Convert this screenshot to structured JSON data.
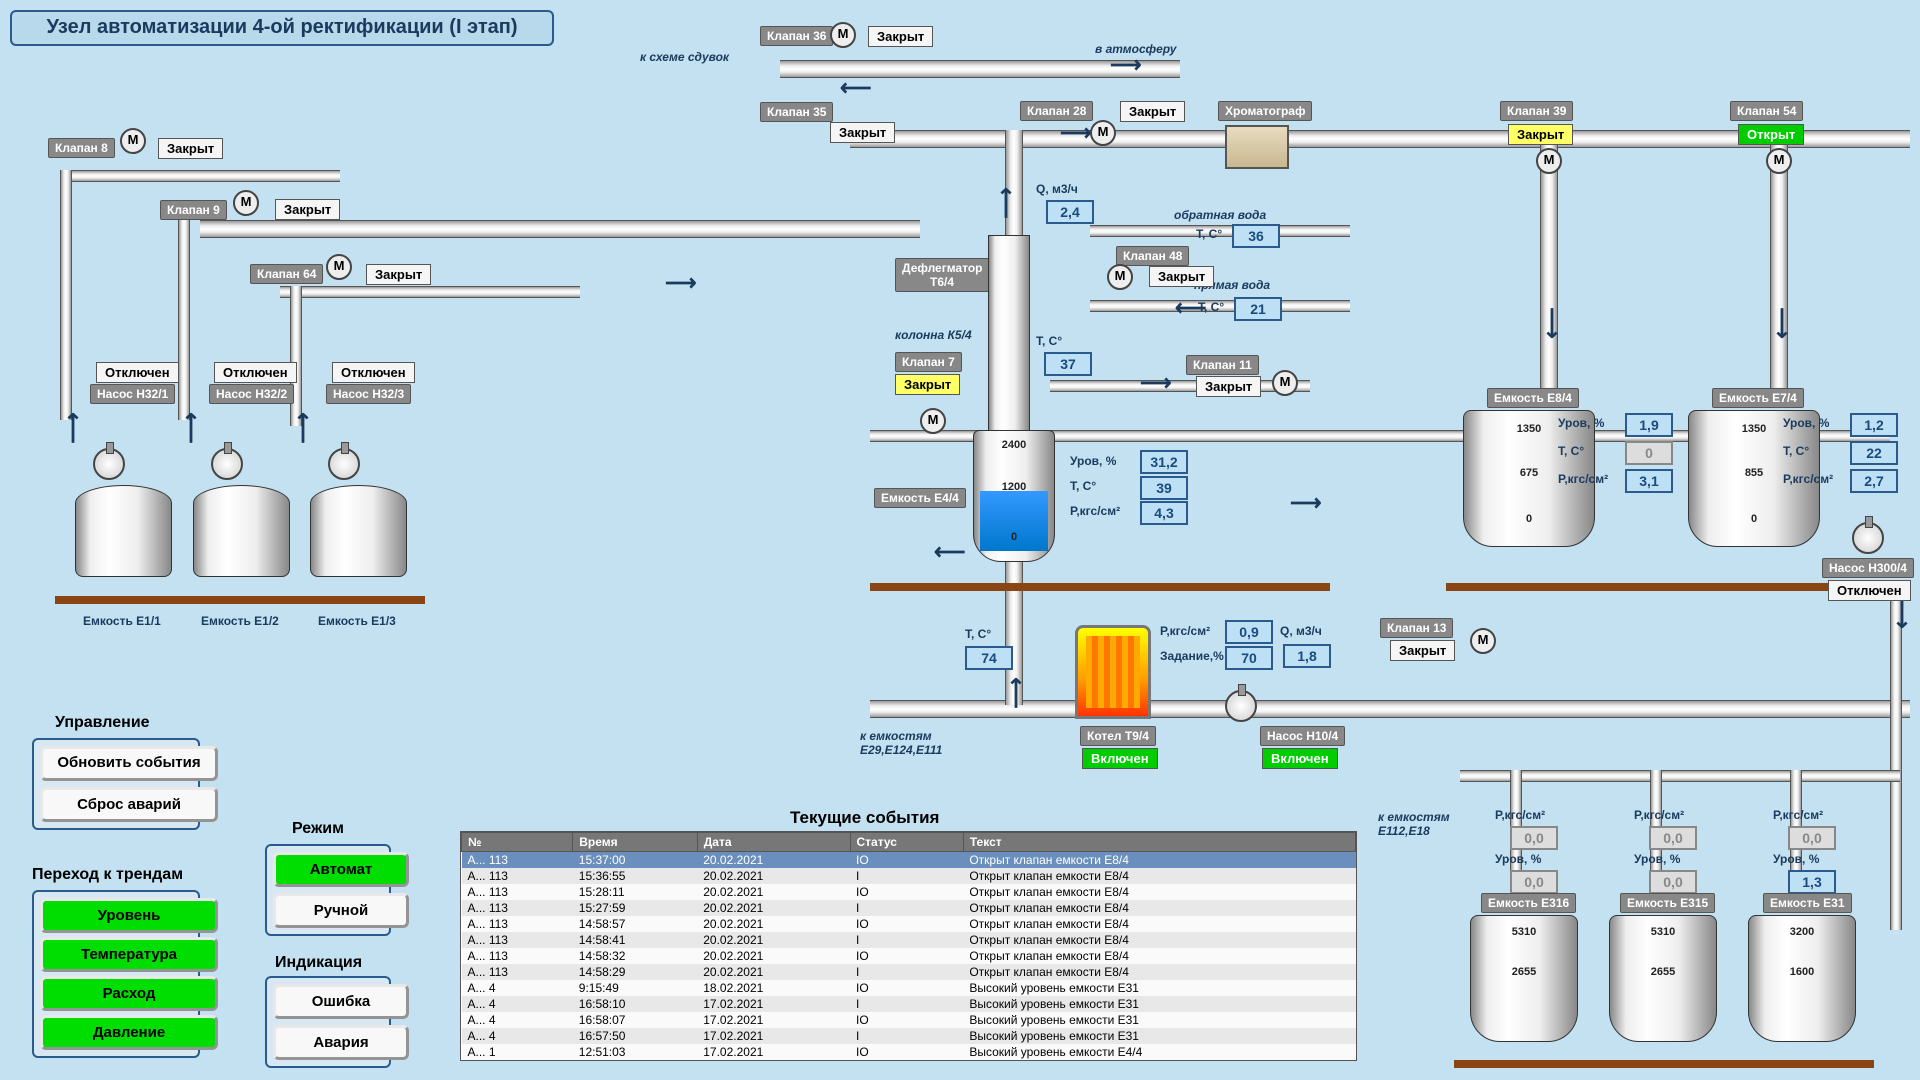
{
  "title": "Узел автоматизации 4-ой ректификации (I этап)",
  "labels": {
    "to_sduvok": "к схеме сдувок",
    "to_atmos": "в атмосферу",
    "chromatograph": "Хроматограф",
    "deflegmator": "Дефлегматор Т6/4",
    "column": "колонна К5/4",
    "obratnaya": "обратная вода",
    "pryamaya": "прямая вода",
    "to_tanks_1": "к емкостям E29,E124,E111",
    "to_tanks_2": "к емкостям E112,E18",
    "q_m3h": "Q, м3/ч",
    "t_c": "T, C°",
    "urov": "Уров, %",
    "p_kgs": "Р,кгс/см²",
    "zadanie": "Задание,%",
    "events_title": "Текущие события"
  },
  "valves": {
    "v8": {
      "tag": "Клапан 8",
      "status": "Закрыт"
    },
    "v9": {
      "tag": "Клапан 9",
      "status": "Закрыт"
    },
    "v64": {
      "tag": "Клапан 64",
      "status": "Закрыт"
    },
    "v36": {
      "tag": "Клапан 36",
      "status": "Закрыт"
    },
    "v35": {
      "tag": "Клапан 35",
      "status": "Закрыт"
    },
    "v28": {
      "tag": "Клапан 28",
      "status": "Закрыт"
    },
    "v7": {
      "tag": "Клапан 7",
      "status": "Закрыт"
    },
    "v48": {
      "tag": "Клапан 48",
      "status": "Закрыт"
    },
    "v11": {
      "tag": "Клапан 11",
      "status": "Закрыт"
    },
    "v39": {
      "tag": "Клапан 39",
      "status": "Закрыт"
    },
    "v54": {
      "tag": "Клапан 54",
      "status": "Открыт"
    },
    "v13": {
      "tag": "Клапан 13",
      "status": "Закрыт"
    }
  },
  "pumps": {
    "n32_1": {
      "tag": "Насос Н32/1",
      "status": "Отключен"
    },
    "n32_2": {
      "tag": "Насос Н32/2",
      "status": "Отключен"
    },
    "n32_3": {
      "tag": "Насос Н32/3",
      "status": "Отключен"
    },
    "n300_4": {
      "tag": "Насос Н300/4",
      "status": "Отключен"
    },
    "n10_4": {
      "tag": "Насос Н10/4",
      "status": "Включен"
    }
  },
  "tanks": {
    "e1_1": "Емкость Е1/1",
    "e1_2": "Емкость Е1/2",
    "e1_3": "Емкость Е1/3",
    "e4_4": "Емкость Е4/4",
    "e8_4": "Емкость Е8/4",
    "e7_4": "Емкость Е7/4",
    "e316": "Емкость Е316",
    "e315": "Емкость Е315",
    "e31": "Емкость Е31"
  },
  "boiler": {
    "tag": "Котел Т9/4",
    "status": "Включен"
  },
  "readings": {
    "q1": "2,4",
    "t36": "36",
    "t21": "21",
    "t37": "37",
    "urov_31_2": "31,2",
    "t39": "39",
    "p4_3": "4,3",
    "t74": "74",
    "p0_9": "0,9",
    "zad70": "70",
    "q1_8": "1,8",
    "e8_urov": "1,9",
    "e8_t": "0",
    "e8_p": "3,1",
    "e7_urov": "1,2",
    "e7_t": "22",
    "e7_p": "2,7",
    "e316_p": "0,0",
    "e316_u": "0,0",
    "e315_p": "0,0",
    "e315_u": "0,0",
    "e31_p": "0,0",
    "e31_u": "1,3"
  },
  "scale_numbers": {
    "col_2400": "2400",
    "col_1200": "1200",
    "col_0": "0",
    "v1350": "1350",
    "v675": "675",
    "v855": "855",
    "v0": "0",
    "s5310": "5310",
    "s2655": "2655",
    "s3200": "3200",
    "s1600": "1600"
  },
  "control": {
    "title": "Управление",
    "refresh": "Обновить события",
    "reset": "Сброс аварий",
    "trends_title": "Переход к трендам",
    "level": "Уровень",
    "temp": "Температура",
    "flow": "Расход",
    "press": "Давление",
    "mode_title": "Режим",
    "auto": "Автомат",
    "manual": "Ручной",
    "ind_title": "Индикация",
    "error": "Ошибка",
    "alarm": "Авария"
  },
  "events": {
    "cols": [
      "№",
      "Время",
      "Дата",
      "Статус",
      "Текст"
    ],
    "rows": [
      [
        "A... 113",
        "15:37:00",
        "20.02.2021",
        "IO",
        "Открыт клапан емкости Е8/4"
      ],
      [
        "A... 113",
        "15:36:55",
        "20.02.2021",
        "I",
        "Открыт клапан емкости Е8/4"
      ],
      [
        "A... 113",
        "15:28:11",
        "20.02.2021",
        "IO",
        "Открыт клапан емкости Е8/4"
      ],
      [
        "A... 113",
        "15:27:59",
        "20.02.2021",
        "I",
        "Открыт клапан емкости Е8/4"
      ],
      [
        "A... 113",
        "14:58:57",
        "20.02.2021",
        "IO",
        "Открыт клапан емкости Е8/4"
      ],
      [
        "A... 113",
        "14:58:41",
        "20.02.2021",
        "I",
        "Открыт клапан емкости Е8/4"
      ],
      [
        "A... 113",
        "14:58:32",
        "20.02.2021",
        "IO",
        "Открыт клапан емкости Е8/4"
      ],
      [
        "A... 113",
        "14:58:29",
        "20.02.2021",
        "I",
        "Открыт клапан емкости Е8/4"
      ],
      [
        "A... 4",
        "9:15:49",
        "18.02.2021",
        "IO",
        "Высокий уровень емкости Е31"
      ],
      [
        "A... 4",
        "16:58:10",
        "17.02.2021",
        "I",
        "Высокий уровень емкости Е31"
      ],
      [
        "A... 4",
        "16:58:07",
        "17.02.2021",
        "IO",
        "Высокий уровень емкости Е31"
      ],
      [
        "A... 4",
        "16:57:50",
        "17.02.2021",
        "I",
        "Высокий уровень емкости Е31"
      ],
      [
        "A... 1",
        "12:51:03",
        "17.02.2021",
        "IO",
        "Высокий уровень емкости Е4/4"
      ]
    ]
  }
}
